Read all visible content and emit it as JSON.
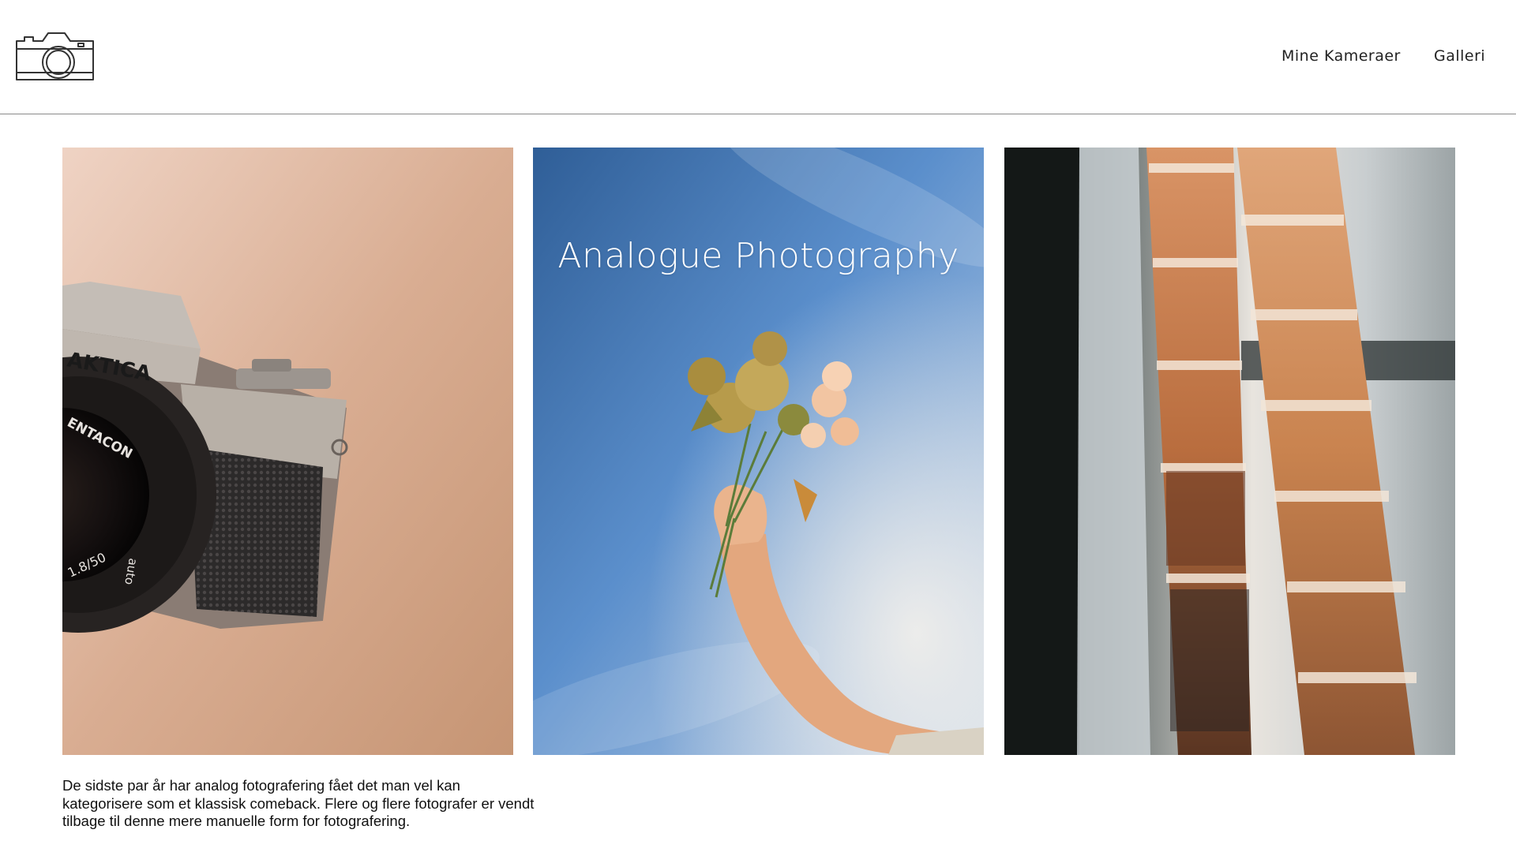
{
  "header": {
    "logo_icon": "camera-outline-icon",
    "nav": [
      {
        "label": "Mine Kameraer"
      },
      {
        "label": "Galleri"
      }
    ]
  },
  "gallery": {
    "title": "Analogue Photography",
    "images": [
      {
        "subject": "vintage-camera",
        "camera_brand": "AKTICA",
        "lens_text": "ENTACON",
        "lens_text2": "auto",
        "lens_spec": "1.8/50"
      },
      {
        "subject": "hand-holding-flowers-against-sky"
      },
      {
        "subject": "film-negative-strips-in-window-light"
      }
    ]
  },
  "intro_text": "De sidste par år har analog fotografering fået det man vel kan kategorisere som et klassisk comeback. Flere og flere fotografer er vendt tilbage til denne mere manuelle form for fotografering.",
  "colors": {
    "divider": "#8a8a8a",
    "text": "#111111"
  }
}
